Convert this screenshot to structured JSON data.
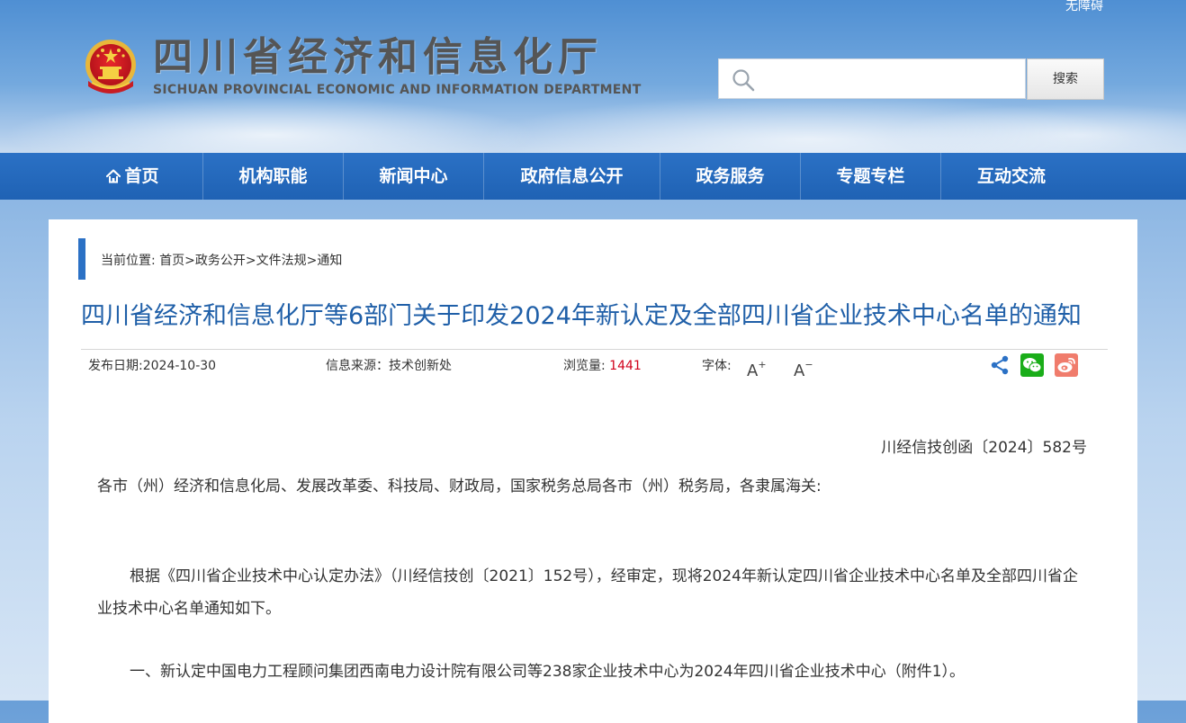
{
  "header": {
    "accessibility_label": "无障碍",
    "title_cn": "四川省经济和信息化厅",
    "title_en": "SICHUAN PROVINCIAL ECONOMIC AND INFORMATION DEPARTMENT",
    "search_placeholder": "",
    "search_button": "搜索"
  },
  "nav": {
    "items": [
      "首页",
      "机构职能",
      "新闻中心",
      "政府信息公开",
      "政务服务",
      "专题专栏",
      "互动交流"
    ]
  },
  "breadcrumb": {
    "prefix": "当前位置:",
    "items": [
      "首页",
      "政务公开",
      "文件法规",
      "通知"
    ],
    "separator": ">"
  },
  "article": {
    "title": "四川省经济和信息化厅等6部门关于印发2024年新认定及全部四川省企业技术中心名单的通知",
    "meta": {
      "date_label": "发布日期:",
      "date": "2024-10-30",
      "source_label": "信息来源：",
      "source": "技术创新处",
      "views_label": "浏览量:",
      "views": "1441",
      "font_label": "字体:"
    },
    "doc_number": "川经信技创函〔2024〕582号",
    "recipients": "各市（州）经济和信息化局、发展改革委、科技局、财政局，国家税务总局各市（州）税务局，各隶属海关:",
    "paragraph_1": "根据《四川省企业技术中心认定办法》（川经信技创〔2021〕152号），经审定，现将2024年新认定四川省企业技术中心名单及全部四川省企业技术中心名单通知如下。",
    "paragraph_2": "一、新认定中国电力工程顾问集团西南电力设计院有限公司等238家企业技术中心为2024年四川省企业技术中心（附件1）。"
  },
  "colors": {
    "nav_blue": "#2b71c5",
    "title_blue": "#1f5fa8",
    "views_red": "#d0021b",
    "wechat_green": "#1aad19",
    "weibo_red": "#e6162d"
  }
}
